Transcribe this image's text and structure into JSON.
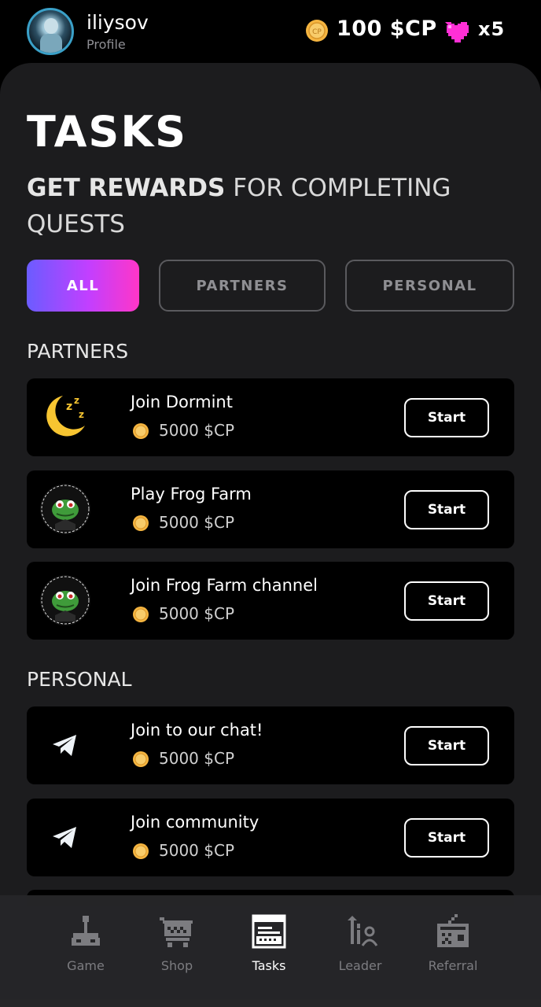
{
  "header": {
    "username": "iliysov",
    "profile_label": "Profile",
    "balance": "100 $CP",
    "lives": "x5"
  },
  "page": {
    "title": "TASKS",
    "subtitle_bold": "GET REWARDS",
    "subtitle_rest": " FOR COMPLETING QUESTS"
  },
  "filters": [
    {
      "label": "ALL",
      "active": true
    },
    {
      "label": "PARTNERS",
      "active": false
    },
    {
      "label": "PERSONAL",
      "active": false
    }
  ],
  "sections": {
    "partners": "PARTNERS",
    "personal": "PERSONAL"
  },
  "tasks": [
    {
      "name": "Join Dormint",
      "reward": "5000 $CP",
      "button": "Start",
      "icon": "moon-icon"
    },
    {
      "name": "Play Frog Farm",
      "reward": "5000 $CP",
      "button": "Start",
      "icon": "frog-farm-icon"
    },
    {
      "name": "Join Frog Farm channel",
      "reward": "5000 $CP",
      "button": "Start",
      "icon": "frog-farm-icon"
    },
    {
      "name": "Join to our chat!",
      "reward": "5000 $CP",
      "button": "Start",
      "icon": "telegram-icon"
    },
    {
      "name": "Join community",
      "reward": "5000 $CP",
      "button": "Start",
      "icon": "telegram-icon"
    }
  ],
  "nav": [
    {
      "label": "Game",
      "icon": "joystick-icon",
      "active": false
    },
    {
      "label": "Shop",
      "icon": "cart-icon",
      "active": false
    },
    {
      "label": "Tasks",
      "icon": "tasks-icon",
      "active": true
    },
    {
      "label": "Leader",
      "icon": "leader-icon",
      "active": false
    },
    {
      "label": "Referral",
      "icon": "radio-icon",
      "active": false
    }
  ],
  "colors": {
    "background": "#000000",
    "panel": "#1c1c1e",
    "accent_gradient_start": "#6b5cff",
    "accent_gradient_end": "#ff36c8",
    "coin": "#f5b540",
    "heart": "#ff2fd6"
  }
}
